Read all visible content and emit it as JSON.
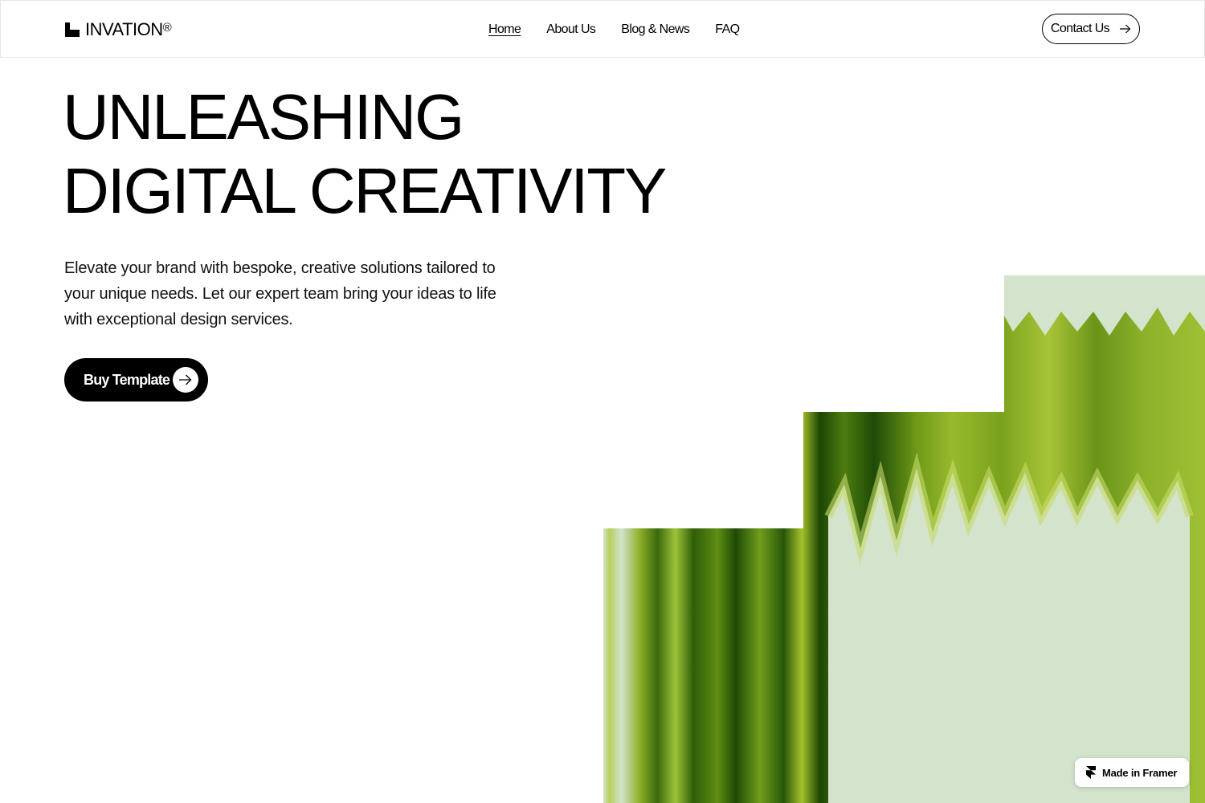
{
  "brand": {
    "name": "INVATION",
    "registered_mark": "®",
    "logo_icon": "brand-logo-icon"
  },
  "nav": {
    "items": [
      {
        "label": "Home",
        "active": true
      },
      {
        "label": "About Us",
        "active": false
      },
      {
        "label": "Blog & News",
        "active": false
      },
      {
        "label": "FAQ",
        "active": false
      }
    ]
  },
  "header": {
    "contact_label": "Contact Us",
    "contact_icon": "arrow-right-icon"
  },
  "hero": {
    "title_line1": "UNLEASHING",
    "title_line2": "DIGITAL CREATIVITY",
    "subtitle": "Elevate your brand with bespoke, creative solutions tailored to your unique needs. Let our expert team bring your ideas to life with exceptional design services.",
    "cta_label": "Buy Template",
    "cta_icon": "arrow-right-icon"
  },
  "badge": {
    "label": "Made in Framer",
    "icon": "framer-logo-icon"
  },
  "colors": {
    "primary": "#000000",
    "background": "#ffffff",
    "art_background": "#d3e3cc",
    "art_green_dark": "#1f4a06",
    "art_green_light": "#a4c22a"
  }
}
